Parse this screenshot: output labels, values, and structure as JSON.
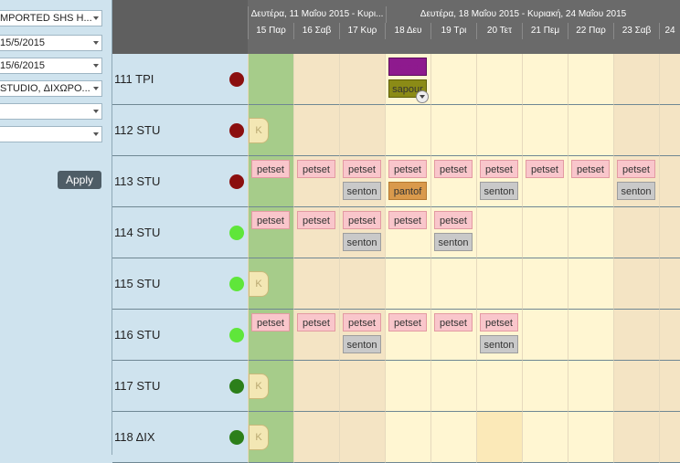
{
  "filters": [
    {
      "value": "MPORTED SHS H..."
    },
    {
      "value": "15/5/2015"
    },
    {
      "value": "15/6/2015"
    },
    {
      "value": "STUDIO, ΔΙΧΩΡΟ..."
    },
    {
      "value": ""
    },
    {
      "value": ""
    }
  ],
  "apply_label": "Apply",
  "weeks": [
    {
      "label": "Δευτέρα, 11 Μαΐου 2015 - Κυρι..."
    },
    {
      "label": "Δευτέρα, 18 Μαΐου 2015 - Κυριακή, 24 Μαΐου 2015"
    }
  ],
  "days": [
    "15 Παρ",
    "16 Σαβ",
    "17 Κυρ",
    "18 Δευ",
    "19 Τρι",
    "20 Τετ",
    "21 Πεμ",
    "22 Παρ",
    "23 Σαβ",
    "24"
  ],
  "rooms": [
    {
      "label": "111  ΤΡΙ",
      "status": "#8b0f0f"
    },
    {
      "label": "112  STU",
      "status": "#8b0f0f"
    },
    {
      "label": "113  STU",
      "status": "#8b0f0f"
    },
    {
      "label": "114  STU",
      "status": "#5fe63a"
    },
    {
      "label": "115  STU",
      "status": "#5fe63a"
    },
    {
      "label": "116  STU",
      "status": "#5fe63a"
    },
    {
      "label": "117  STU",
      "status": "#2c7f1a"
    },
    {
      "label": "118  ΔΙΧ",
      "status": "#2c7f1a"
    }
  ],
  "events": {
    "petset": "petset",
    "senton": "senton",
    "pantof": "pantof",
    "sapour": "sapour",
    "purple": "petset"
  },
  "kmark": "K"
}
